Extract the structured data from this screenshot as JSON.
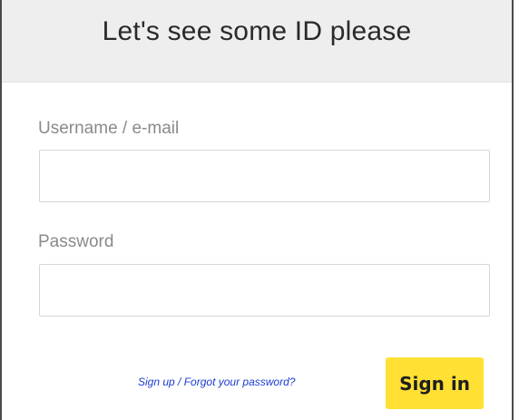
{
  "header": {
    "title": "Let's see some ID please"
  },
  "form": {
    "username_label": "Username / e-mail",
    "username_value": "",
    "password_label": "Password",
    "password_value": "",
    "signup_link": "Sign up",
    "separator": " / ",
    "forgot_link": "Forgot your password?",
    "signin_label": "Sign in"
  },
  "colors": {
    "header_bg": "#eeeeee",
    "signin_button_bg": "#ffe033",
    "link": "#1a3ccf"
  }
}
